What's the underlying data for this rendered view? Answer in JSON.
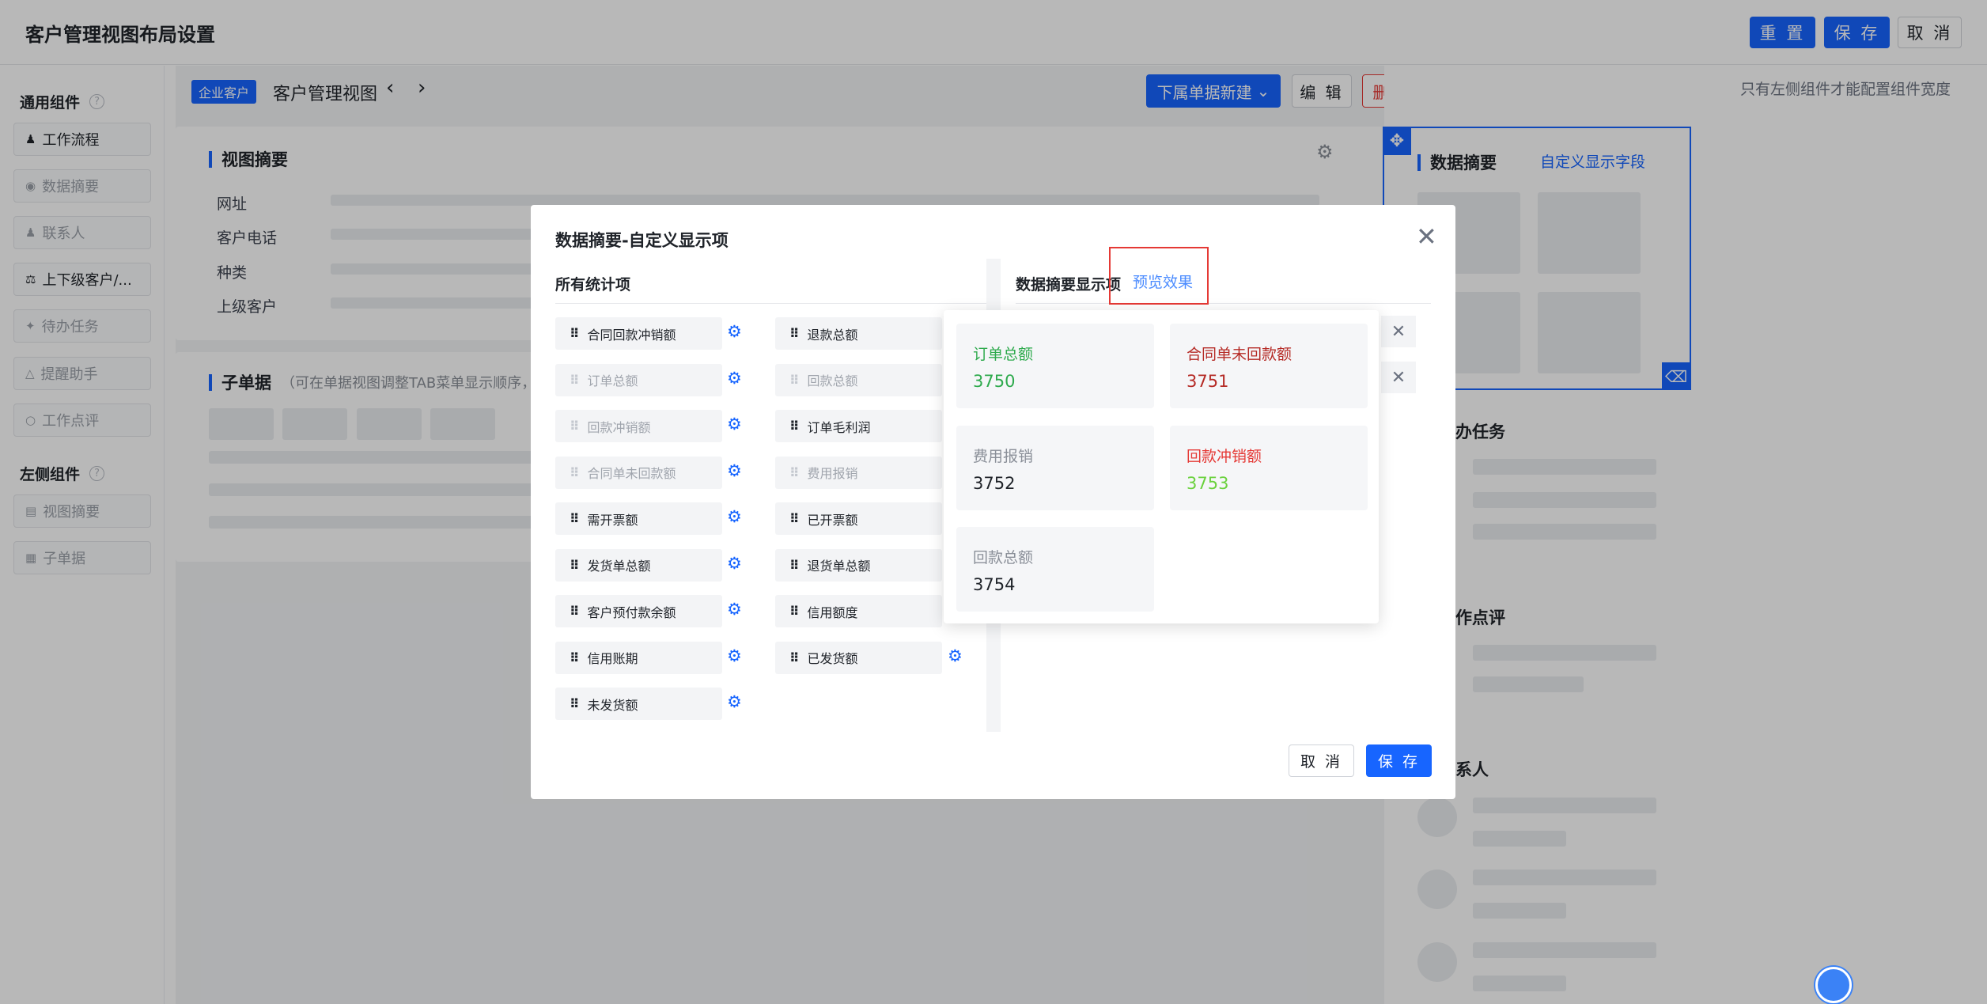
{
  "header": {
    "title": "客户管理视图布局设置",
    "reset_label": "重 置",
    "save_label": "保 存",
    "cancel_label": "取 消"
  },
  "sidebar": {
    "common_title": "通用组件",
    "common_items": [
      {
        "label": "工作流程",
        "icon": "person-icon"
      },
      {
        "label": "数据摘要",
        "icon": "eye-icon"
      },
      {
        "label": "联系人",
        "icon": "person-icon"
      },
      {
        "label": "上下级客户/...",
        "icon": "hierarchy-icon"
      },
      {
        "label": "待办任务",
        "icon": "pin-icon"
      },
      {
        "label": "提醒助手",
        "icon": "bell-icon"
      },
      {
        "label": "工作点评",
        "icon": "comment-icon"
      }
    ],
    "left_title": "左侧组件",
    "left_items": [
      {
        "label": "视图摘要",
        "icon": "list-icon"
      },
      {
        "label": "子单据",
        "icon": "grid-icon"
      }
    ]
  },
  "view": {
    "tag": "企业客户",
    "title": "客户管理视图",
    "new_sub_label": "下属单据新建",
    "edit_label": "编 辑",
    "delete_label": "删 除",
    "summary_title": "视图摘要",
    "fields": [
      "网址",
      "客户电话",
      "种类",
      "上级客户"
    ],
    "sub_title": "子单据",
    "sub_hint": "（可在单据视图调整TAB菜单显示顺序，修"
  },
  "right": {
    "note": "只有左侧组件才能配置组件宽度",
    "data_summary_title": "数据摘要",
    "custom_link": "自定义显示字段",
    "todo_title": "办任务",
    "review_title": "作点评",
    "contact_title": "系人"
  },
  "modal": {
    "title": "数据摘要-自定义显示项",
    "all_items_title": "所有统计项",
    "display_title": "数据摘要显示项",
    "preview_label": "预览效果",
    "left_items": [
      {
        "label": "合同回款冲销额",
        "dim": false
      },
      {
        "label": "订单总额",
        "dim": true
      },
      {
        "label": "回款冲销额",
        "dim": true
      },
      {
        "label": "合同单未回款额",
        "dim": true
      },
      {
        "label": "需开票额",
        "dim": false
      },
      {
        "label": "发货单总额",
        "dim": false
      },
      {
        "label": "客户预付款余额",
        "dim": false
      },
      {
        "label": "信用账期",
        "dim": false
      },
      {
        "label": "未发货额",
        "dim": false
      }
    ],
    "right_items": [
      {
        "label": "退款总额",
        "dim": false
      },
      {
        "label": "回款总额",
        "dim": true
      },
      {
        "label": "订单毛利润",
        "dim": false
      },
      {
        "label": "费用报销",
        "dim": true
      },
      {
        "label": "已开票额",
        "dim": false
      },
      {
        "label": "退货单总额",
        "dim": false
      },
      {
        "label": "信用额度",
        "dim": false
      },
      {
        "label": "已发货额",
        "dim": false
      }
    ],
    "preview_cards": [
      {
        "label": "订单总额",
        "value": "3750",
        "label_color": "#2eaa4d",
        "value_color": "#2eaa4d"
      },
      {
        "label": "合同单未回款额",
        "value": "3751",
        "label_color": "#b52a25",
        "value_color": "#b52a25"
      },
      {
        "label": "费用报销",
        "value": "3752",
        "label_color": "#8a8f98",
        "value_color": "#1f2329"
      },
      {
        "label": "回款冲销额",
        "value": "3753",
        "label_color": "#e53935",
        "value_color": "#6ad13d"
      },
      {
        "label": "回款总额",
        "value": "3754",
        "label_color": "#8a8f98",
        "value_color": "#1f2329"
      }
    ],
    "cancel_label": "取 消",
    "save_label": "保 存"
  }
}
